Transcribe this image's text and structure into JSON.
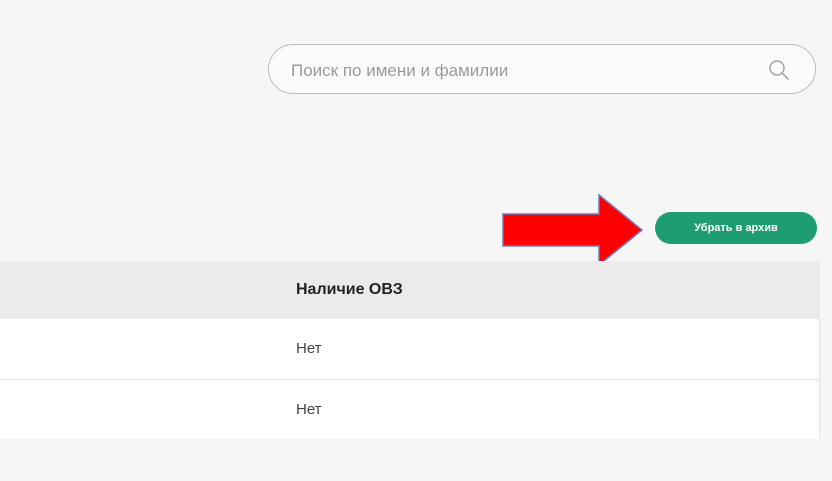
{
  "search": {
    "placeholder": "Поиск по имени и фамилии",
    "icon": "search-icon"
  },
  "archive_button": {
    "label": "Убрать в архив",
    "color": "#1e9d73"
  },
  "annotation": {
    "arrow_color": "#ff0000",
    "arrow_direction": "right"
  },
  "table": {
    "columns": [
      "Наличие ОВЗ"
    ],
    "rows": [
      [
        "Нет"
      ],
      [
        "Нет"
      ]
    ]
  }
}
